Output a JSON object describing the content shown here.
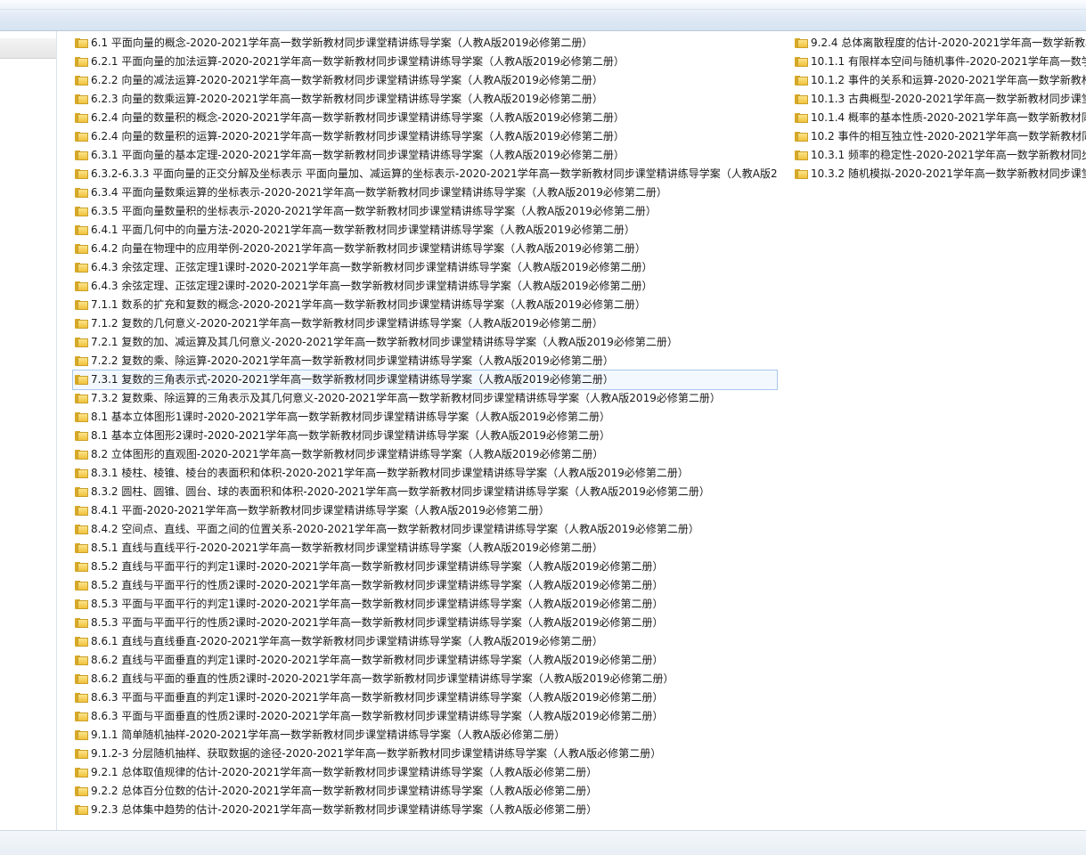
{
  "window": {
    "accent_color": "#d6e3f1",
    "folder_color": "#f1c23c"
  },
  "files": {
    "column1": [
      {
        "name": "6.1 平面向量的概念-2020-2021学年高一数学新教材同步课堂精讲练导学案（人教A版2019必修第二册）"
      },
      {
        "name": "6.2.1 平面向量的加法运算-2020-2021学年高一数学新教材同步课堂精讲练导学案（人教A版2019必修第二册）"
      },
      {
        "name": "6.2.2 向量的减法运算-2020-2021学年高一数学新教材同步课堂精讲练导学案（人教A版2019必修第二册）"
      },
      {
        "name": "6.2.3 向量的数乘运算-2020-2021学年高一数学新教材同步课堂精讲练导学案（人教A版2019必修第二册）"
      },
      {
        "name": "6.2.4 向量的数量积的概念-2020-2021学年高一数学新教材同步课堂精讲练导学案（人教A版2019必修第二册）"
      },
      {
        "name": "6.2.4 向量的数量积的运算-2020-2021学年高一数学新教材同步课堂精讲练导学案（人教A版2019必修第二册）"
      },
      {
        "name": "6.3.1 平面向量的基本定理-2020-2021学年高一数学新教材同步课堂精讲练导学案（人教A版2019必修第二册）"
      },
      {
        "name": "6.3.2-6.3.3 平面向量的正交分解及坐标表示 平面向量加、减运算的坐标表示-2020-2021学年高一数学新教材同步课堂精讲练导学案（人教A版2..."
      },
      {
        "name": "6.3.4 平面向量数乘运算的坐标表示-2020-2021学年高一数学新教材同步课堂精讲练导学案（人教A版2019必修第二册）"
      },
      {
        "name": "6.3.5 平面向量数量积的坐标表示-2020-2021学年高一数学新教材同步课堂精讲练导学案（人教A版2019必修第二册）"
      },
      {
        "name": "6.4.1 平面几何中的向量方法-2020-2021学年高一数学新教材同步课堂精讲练导学案（人教A版2019必修第二册）"
      },
      {
        "name": "6.4.2 向量在物理中的应用举例-2020-2021学年高一数学新教材同步课堂精讲练导学案（人教A版2019必修第二册）"
      },
      {
        "name": "6.4.3 余弦定理、正弦定理1课时-2020-2021学年高一数学新教材同步课堂精讲练导学案（人教A版2019必修第二册）"
      },
      {
        "name": "6.4.3 余弦定理、正弦定理2课时-2020-2021学年高一数学新教材同步课堂精讲练导学案（人教A版2019必修第二册）"
      },
      {
        "name": "7.1.1 数系的扩充和复数的概念-2020-2021学年高一数学新教材同步课堂精讲练导学案（人教A版2019必修第二册）"
      },
      {
        "name": "7.1.2 复数的几何意义-2020-2021学年高一数学新教材同步课堂精讲练导学案（人教A版2019必修第二册）"
      },
      {
        "name": "7.2.1 复数的加、减运算及其几何意义-2020-2021学年高一数学新教材同步课堂精讲练导学案（人教A版2019必修第二册）"
      },
      {
        "name": "7.2.2 复数的乘、除运算-2020-2021学年高一数学新教材同步课堂精讲练导学案（人教A版2019必修第二册）"
      },
      {
        "name": "7.3.1 复数的三角表示式-2020-2021学年高一数学新教材同步课堂精讲练导学案（人教A版2019必修第二册）",
        "selected": true
      },
      {
        "name": "7.3.2 复数乘、除运算的三角表示及其几何意义-2020-2021学年高一数学新教材同步课堂精讲练导学案（人教A版2019必修第二册）"
      },
      {
        "name": "8.1 基本立体图形1课时-2020-2021学年高一数学新教材同步课堂精讲练导学案（人教A版2019必修第二册）"
      },
      {
        "name": "8.1 基本立体图形2课时-2020-2021学年高一数学新教材同步课堂精讲练导学案（人教A版2019必修第二册）"
      },
      {
        "name": "8.2 立体图形的直观图-2020-2021学年高一数学新教材同步课堂精讲练导学案（人教A版2019必修第二册）"
      },
      {
        "name": "8.3.1 棱柱、棱锥、棱台的表面积和体积-2020-2021学年高一数学新教材同步课堂精讲练导学案（人教A版2019必修第二册）"
      },
      {
        "name": "8.3.2 圆柱、圆锥、圆台、球的表面积和体积-2020-2021学年高一数学新教材同步课堂精讲练导学案（人教A版2019必修第二册）"
      },
      {
        "name": "8.4.1 平面-2020-2021学年高一数学新教材同步课堂精讲练导学案（人教A版2019必修第二册）"
      },
      {
        "name": "8.4.2 空间点、直线、平面之间的位置关系-2020-2021学年高一数学新教材同步课堂精讲练导学案（人教A版2019必修第二册）"
      },
      {
        "name": "8.5.1 直线与直线平行-2020-2021学年高一数学新教材同步课堂精讲练导学案（人教A版2019必修第二册）"
      },
      {
        "name": "8.5.2 直线与平面平行的判定1课时-2020-2021学年高一数学新教材同步课堂精讲练导学案（人教A版2019必修第二册）"
      },
      {
        "name": "8.5.2 直线与平面平行的性质2课时-2020-2021学年高一数学新教材同步课堂精讲练导学案（人教A版2019必修第二册）"
      },
      {
        "name": "8.5.3 平面与平面平行的判定1课时-2020-2021学年高一数学新教材同步课堂精讲练导学案（人教A版2019必修第二册）"
      },
      {
        "name": "8.5.3 平面与平面平行的性质2课时-2020-2021学年高一数学新教材同步课堂精讲练导学案（人教A版2019必修第二册）"
      },
      {
        "name": "8.6.1 直线与直线垂直-2020-2021学年高一数学新教材同步课堂精讲练导学案（人教A版2019必修第二册）"
      },
      {
        "name": "8.6.2 直线与平面垂直的判定1课时-2020-2021学年高一数学新教材同步课堂精讲练导学案（人教A版2019必修第二册）"
      },
      {
        "name": "8.6.2 直线与平面的垂直的性质2课时-2020-2021学年高一数学新教材同步课堂精讲练导学案（人教A版2019必修第二册）"
      },
      {
        "name": "8.6.3 平面与平面垂直的判定1课时-2020-2021学年高一数学新教材同步课堂精讲练导学案（人教A版2019必修第二册）"
      },
      {
        "name": "8.6.3 平面与平面垂直的性质2课时-2020-2021学年高一数学新教材同步课堂精讲练导学案（人教A版2019必修第二册）"
      },
      {
        "name": "9.1.1 简单随机抽样-2020-2021学年高一数学新教材同步课堂精讲练导学案（人教A版必修第二册）"
      },
      {
        "name": "9.1.2-3 分层随机抽样、获取数据的途径-2020-2021学年高一数学新教材同步课堂精讲练导学案（人教A版必修第二册）"
      },
      {
        "name": "9.2.1 总体取值规律的估计-2020-2021学年高一数学新教材同步课堂精讲练导学案（人教A版必修第二册）"
      },
      {
        "name": "9.2.2 总体百分位数的估计-2020-2021学年高一数学新教材同步课堂精讲练导学案（人教A版必修第二册）"
      },
      {
        "name": "9.2.3 总体集中趋势的估计-2020-2021学年高一数学新教材同步课堂精讲练导学案（人教A版必修第二册）"
      }
    ],
    "column2": [
      {
        "name": "9.2.4 总体离散程度的估计-2020-2021学年高一数学新教材"
      },
      {
        "name": "10.1.1 有限样本空间与随机事件-2020-2021学年高一数学"
      },
      {
        "name": "10.1.2 事件的关系和运算-2020-2021学年高一数学新教材"
      },
      {
        "name": "10.1.3 古典概型-2020-2021学年高一数学新教材同步课堂"
      },
      {
        "name": "10.1.4 概率的基本性质-2020-2021学年高一数学新教材同"
      },
      {
        "name": "10.2 事件的相互独立性-2020-2021学年高一数学新教材同"
      },
      {
        "name": "10.3.1 频率的稳定性-2020-2021学年高一数学新教材同步"
      },
      {
        "name": "10.3.2 随机模拟-2020-2021学年高一数学新教材同步课堂"
      }
    ]
  }
}
